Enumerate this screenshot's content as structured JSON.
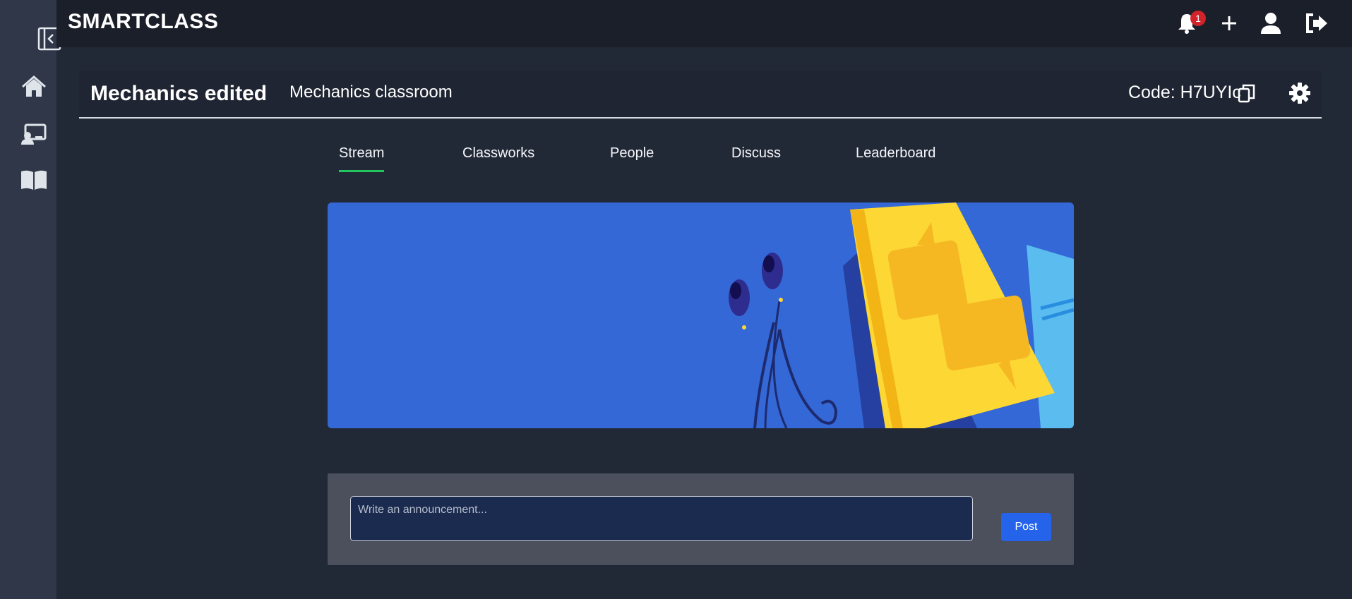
{
  "app": {
    "brand": "SMARTCLASS"
  },
  "topbar": {
    "notification_count": "1",
    "icons": [
      "bell-icon",
      "plus-icon",
      "user-icon",
      "logout-icon"
    ]
  },
  "sidebar": {
    "items": [
      {
        "icon": "home-icon"
      },
      {
        "icon": "classroom-icon"
      },
      {
        "icon": "book-icon"
      }
    ]
  },
  "classroom": {
    "title": "Mechanics edited",
    "subtitle": "Mechanics classroom",
    "code_label": "Code: H7UYIc"
  },
  "tabs": [
    {
      "label": "Stream",
      "active": true
    },
    {
      "label": "Classworks",
      "active": false
    },
    {
      "label": "People",
      "active": false
    },
    {
      "label": "Discuss",
      "active": false
    },
    {
      "label": "Leaderboard",
      "active": false
    }
  ],
  "composer": {
    "placeholder": "Write an announcement...",
    "post_label": "Post"
  },
  "colors": {
    "accent": "#2563eb",
    "tab_indicator": "#22c55e",
    "banner": "#3468d6",
    "badge": "#d1232a"
  }
}
